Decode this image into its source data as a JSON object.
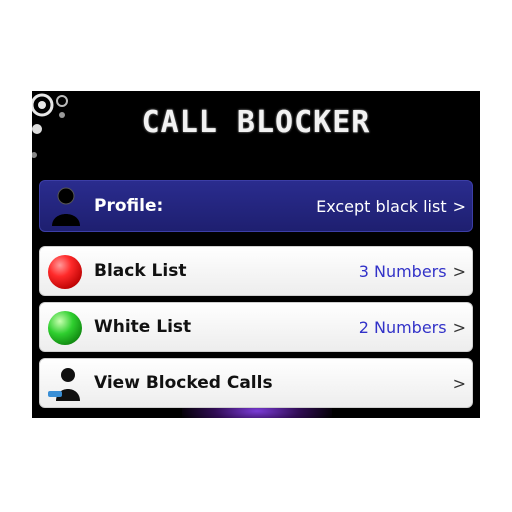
{
  "header": {
    "title": "CALL BLOCKER"
  },
  "profile": {
    "label": "Profile:",
    "value": "Except black list",
    "chevron": ">"
  },
  "items": [
    {
      "label": "Black List",
      "value": "3 Numbers",
      "chevron": ">",
      "icon": "red-ball-icon"
    },
    {
      "label": "White List",
      "value": "2 Numbers",
      "chevron": ">",
      "icon": "green-ball-icon"
    },
    {
      "label": "View Blocked Calls",
      "value": "",
      "chevron": ">",
      "icon": "blocked-person-icon"
    }
  ],
  "colors": {
    "profile_bg": "#23247a",
    "value_text": "#3232c8",
    "background": "#000000"
  }
}
